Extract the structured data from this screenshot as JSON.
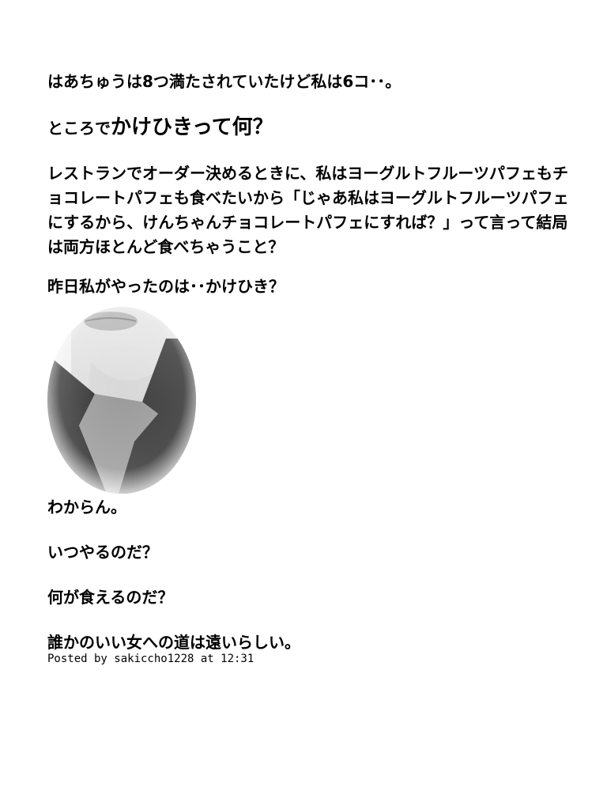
{
  "post": {
    "line1": "はあちゅうは8つ満たされていたけど私は6コ･･。",
    "line2_small": "ところで",
    "line2_big": "かけひきって何？",
    "paragraph": "レストランでオーダー決めるときに、私はヨーグルトフルーツパフェもチョコレートパフェも食べたいから「じゃあ私はヨーグルトフルーツパフェにするから、けんちゃんチョコレートパフェにすれば？」って言って結局は両方ほとんど食べちゃうこと？",
    "line4": "昨日私がやったのは･･かけひき？",
    "line5": "わからん。",
    "line6": "いつやるのだ？",
    "line7": "何が食えるのだ？",
    "line8": "誰かのいい女への道は遠いらしい。"
  },
  "footer": {
    "posted_by": "Posted by sakiccho1228 at 12:31"
  }
}
